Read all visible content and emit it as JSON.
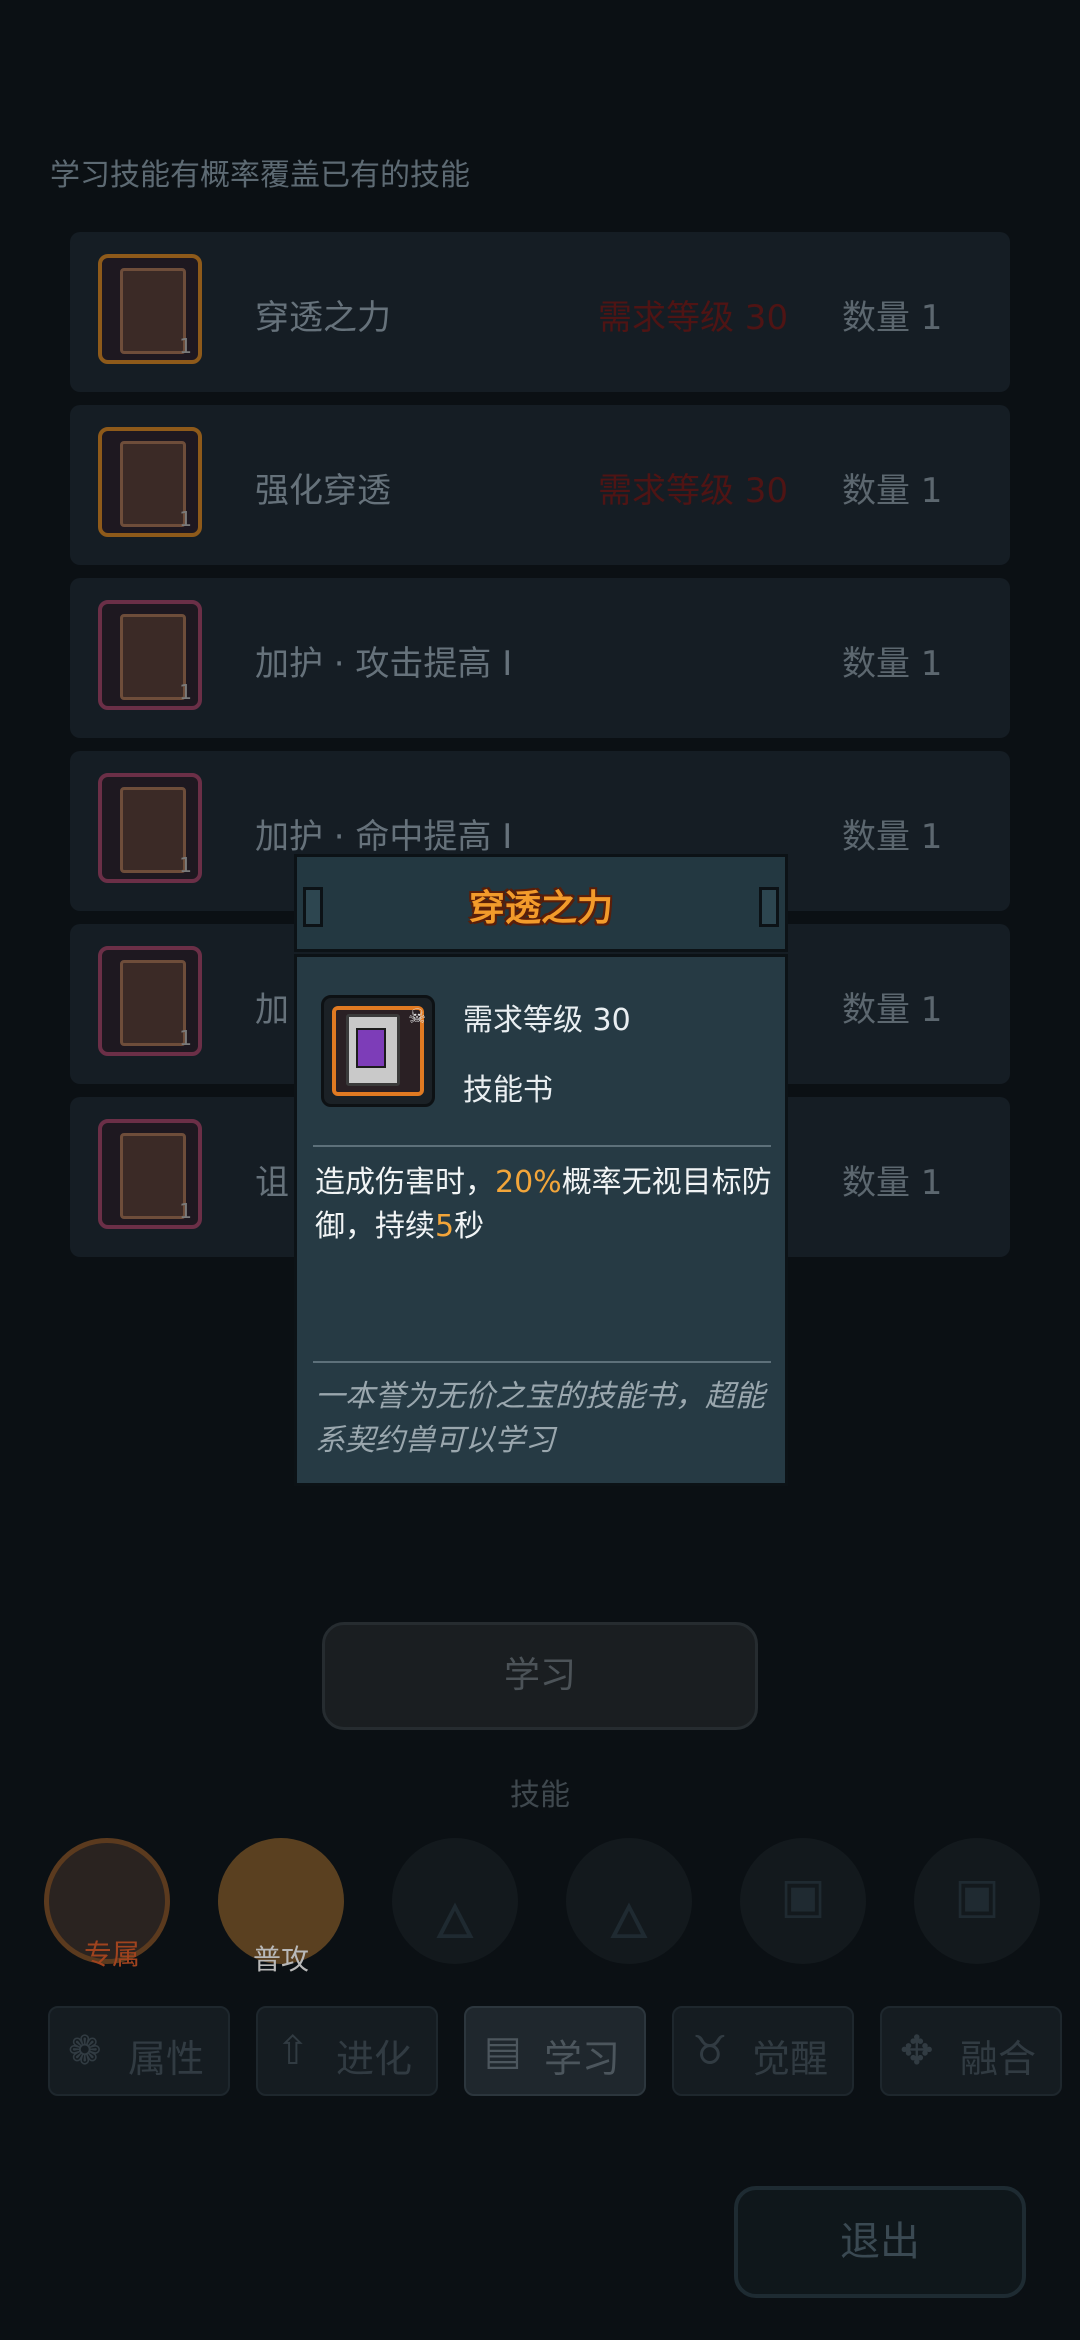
{
  "screen": {
    "hint": "学习技能有概率覆盖已有的技能",
    "skills": [
      {
        "name": "穿透之力",
        "requirement": "需求等级 30",
        "quantity": "数量 1",
        "count": "1"
      },
      {
        "name": "强化穿透",
        "requirement": "需求等级 30",
        "quantity": "数量 1",
        "count": "1"
      },
      {
        "name": "加护 · 攻击提高 I",
        "requirement": "",
        "quantity": "数量 1",
        "count": "1"
      },
      {
        "name": "加护 · 命中提高 I",
        "requirement": "",
        "quantity": "数量 1",
        "count": "1"
      },
      {
        "name": "加",
        "requirement": "",
        "quantity": "数量 1",
        "count": "1"
      },
      {
        "name": "诅",
        "requirement": "",
        "quantity": "数量 1",
        "count": "1"
      }
    ],
    "learn_button": "学习",
    "skills_label": "技能",
    "slots": [
      {
        "label": "专属",
        "icon": "wolf-emblem-icon"
      },
      {
        "label": "普攻",
        "icon": "claw-slash-icon"
      },
      {
        "label": "",
        "icon": "flame-icon"
      },
      {
        "label": "",
        "icon": "flame-icon"
      },
      {
        "label": "",
        "icon": "lock-icon"
      },
      {
        "label": "",
        "icon": "lock-icon"
      }
    ],
    "tabs": [
      {
        "label": "属性",
        "icon": "paw-icon",
        "active": false
      },
      {
        "label": "进化",
        "icon": "arrow-up-icon",
        "active": false
      },
      {
        "label": "学习",
        "icon": "book-icon",
        "active": true
      },
      {
        "label": "觉醒",
        "icon": "beast-head-icon",
        "active": false
      },
      {
        "label": "融合",
        "icon": "merge-icon",
        "active": false
      }
    ],
    "exit_button": "退出"
  },
  "popup": {
    "title": "穿透之力",
    "requirement": "需求等级 30",
    "type": "技能书",
    "desc_1": "造成伤害时，",
    "desc_pct": "20%",
    "desc_2": "概率无视目标防御，持续",
    "desc_sec": "5",
    "desc_3": "秒",
    "flavor": "一本誉为无价之宝的技能书，超能系契约兽可以学习"
  },
  "colors": {
    "accent_orange": "#f2a53a",
    "title_orange": "#f29b2b",
    "requirement_red": "#4f1414",
    "popup_bg": "#263a44"
  }
}
